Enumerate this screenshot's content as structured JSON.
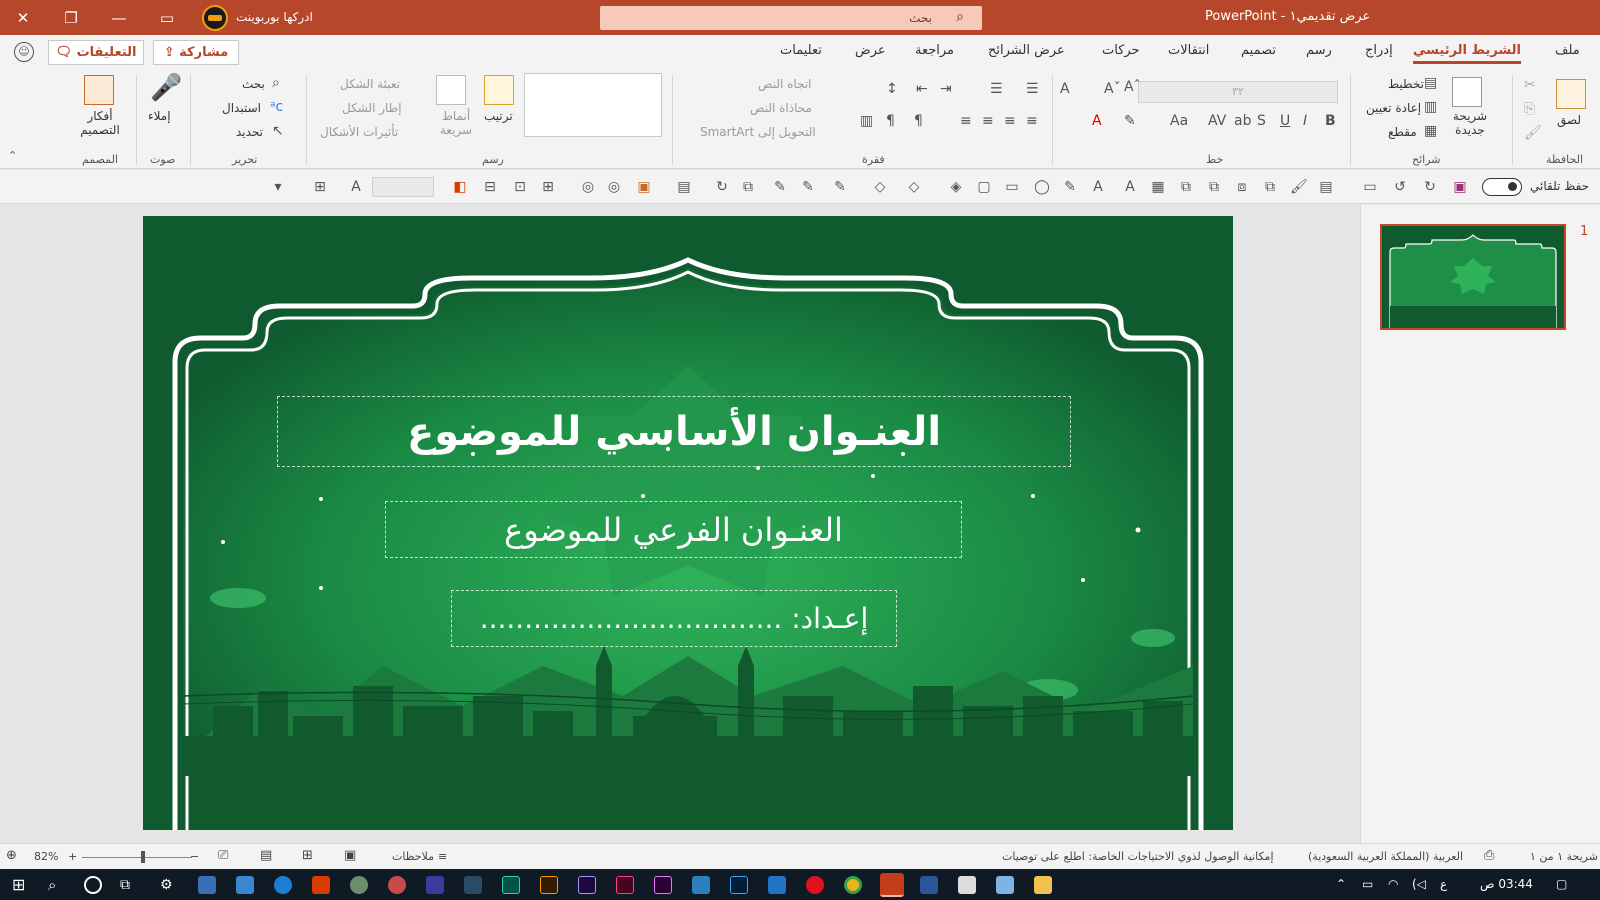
{
  "titlebar": {
    "doc_title": "عرض تقديمي١ - PowerPoint",
    "search_placeholder": "بحث",
    "user_name": "ادركها بوربوينت"
  },
  "tabs": [
    {
      "label": "ملف"
    },
    {
      "label": "الشريط الرئيسي"
    },
    {
      "label": "إدراج"
    },
    {
      "label": "رسم"
    },
    {
      "label": "تصميم"
    },
    {
      "label": "انتقالات"
    },
    {
      "label": "حركات"
    },
    {
      "label": "عرض الشرائح"
    },
    {
      "label": "مراجعة"
    },
    {
      "label": "عرض"
    },
    {
      "label": "تعليمات"
    }
  ],
  "header_actions": {
    "share": "مشاركة",
    "comments": "التعليقات"
  },
  "ribbon": {
    "clipboard": {
      "label": "الحافظة",
      "paste": "لصق"
    },
    "slides": {
      "label": "شرائح",
      "new_slide": "شريحة جديدة",
      "layout": "تخطيط",
      "reset": "إعادة تعيين",
      "section": "مقطع"
    },
    "font": {
      "label": "خط",
      "size": "٣٢"
    },
    "paragraph": {
      "label": "فقرة",
      "text_direction": "اتجاه النص",
      "align_text": "محاذاة النص",
      "smartart": "التحويل إلى SmartArt"
    },
    "drawing": {
      "label": "رسم",
      "arrange": "ترتيب",
      "quick_styles": "أنماط سريعة",
      "shape_fill": "تعبئة الشكل",
      "shape_outline": "إطار الشكل",
      "shape_effects": "تأثيرات الأشكال"
    },
    "editing": {
      "label": "تحرير",
      "find": "بحث",
      "replace": "استبدال",
      "select": "تحديد"
    },
    "voice": {
      "label": "صوت",
      "dictate": "إملاء"
    },
    "designer": {
      "label": "المصمم",
      "design_ideas": "أفكار التصميم"
    }
  },
  "qat": {
    "autosave": "حفظ تلقائي"
  },
  "slide": {
    "title": "العنـوان الأساسي للموضوع",
    "subtitle": "العنـوان الفرعي للموضوع",
    "author": "إعـداد: .................................."
  },
  "thumbnails": [
    {
      "number": "1"
    }
  ],
  "statusbar": {
    "slide_info": "شريحة ١ من ١",
    "language": "العربية (المملكة العربية السعودية)",
    "accessibility": "إمكانية الوصول لذوي الاحتياجات الخاصة: اطلع على توصيات",
    "notes": "ملاحظات",
    "zoom": "82%"
  },
  "taskbar": {
    "time": "03:44 ص",
    "lang": "ع"
  },
  "colors": {
    "accent": "#b7472a",
    "slide_bg": "#0f5a2e",
    "slide_green": "#1f8f47"
  }
}
